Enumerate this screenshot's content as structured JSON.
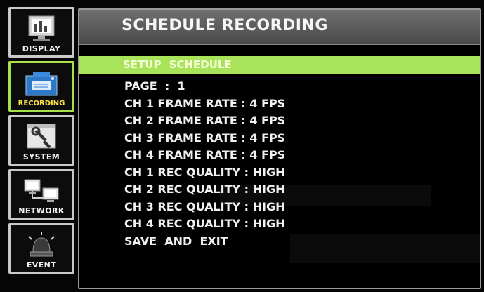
{
  "sidebar": {
    "items": [
      {
        "label": "DISPLAY",
        "icon": "display-icon",
        "active": false
      },
      {
        "label": "RECORDING",
        "icon": "recording-icon",
        "active": true
      },
      {
        "label": "SYSTEM",
        "icon": "system-icon",
        "active": false
      },
      {
        "label": "NETWORK",
        "icon": "network-icon",
        "active": false
      },
      {
        "label": "EVENT",
        "icon": "event-icon",
        "active": false
      }
    ]
  },
  "header": {
    "title": "SCHEDULE RECORDING"
  },
  "menu": {
    "selected": "SETUP  SCHEDULE",
    "items": [
      "PAGE  :  1",
      "CH 1 FRAME RATE : 4 FPS",
      "CH 2 FRAME RATE : 4 FPS",
      "CH 3 FRAME RATE : 4 FPS",
      "CH 4 FRAME RATE : 4 FPS",
      "CH 1 REC QUALITY : HIGH",
      "CH 2 REC QUALITY : HIGH",
      "CH 3 REC QUALITY : HIGH",
      "CH 4 REC QUALITY : HIGH",
      "SAVE  AND  EXIT"
    ]
  },
  "colors": {
    "highlight": "#a8e35a",
    "active_border": "#a6e04c",
    "active_label": "#ffe44a",
    "title_bar": "#5a5a5a"
  }
}
